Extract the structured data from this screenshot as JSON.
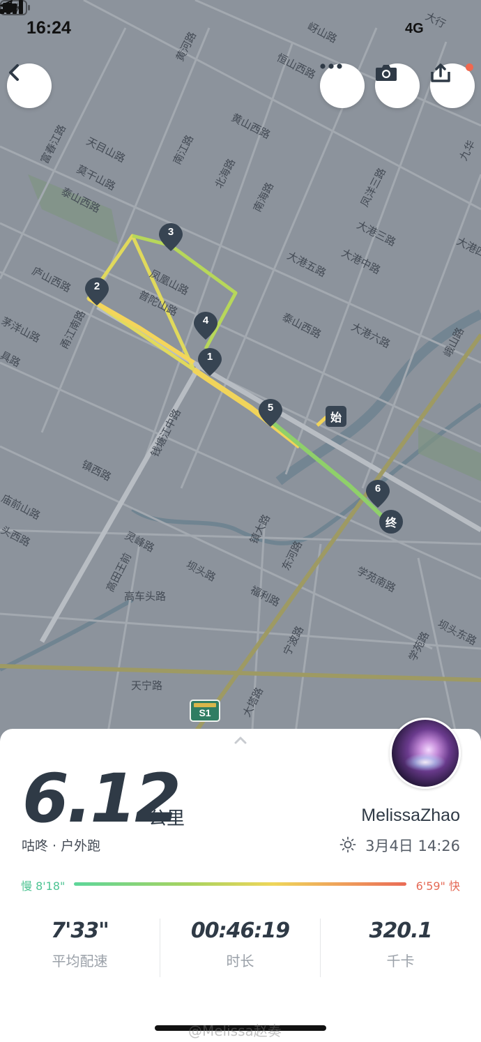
{
  "status_bar": {
    "time": "16:24",
    "network": "4G"
  },
  "map": {
    "roads": [
      "岈山路",
      "恒山西路",
      "大行",
      "黄河路",
      "黄山西路",
      "九华",
      "富春江路",
      "天目山路",
      "南江路",
      "莫干山路",
      "北海路",
      "南海路",
      "凤洋三路",
      "泰山西路",
      "大港三路",
      "大港四",
      "大港中路",
      "大港五路",
      "庐山西路",
      "凤凰山路",
      "普陀山路",
      "泰山西路",
      "大港六路",
      "峨山路",
      "茅洋山路",
      "甬江南路",
      "具路",
      "钱塘江中路",
      "镇西路",
      "庙前山路",
      "头西路",
      "灵峰路",
      "镇大路",
      "东河路",
      "学苑南路",
      "高田王前",
      "坝头路",
      "高车头路",
      "福利路",
      "坝头东路",
      "学苑路",
      "宁波路",
      "天宁路",
      "大塔路"
    ],
    "waypoints": [
      "1",
      "2",
      "3",
      "4",
      "5",
      "6"
    ],
    "start_label": "始",
    "end_label": "终",
    "highway_shield": "S1"
  },
  "buttons": {
    "back": "chevron-left-icon",
    "more": "more-dots-icon",
    "camera": "camera-icon",
    "share": "share-icon"
  },
  "summary": {
    "distance": "6.12",
    "unit": "公里",
    "activity": "咕咚 · 户外跑",
    "username": "MelissaZhao",
    "date": "3月4日 14:26",
    "slow_label": "慢 8'18\"",
    "fast_label": "6'59\" 快"
  },
  "stats": [
    {
      "value": "7'33\"",
      "label": "平均配速"
    },
    {
      "value": "00:46:19",
      "label": "时长"
    },
    {
      "value": "320.1",
      "label": "千卡"
    }
  ],
  "watermark": "@Melissa赵奏",
  "colors": {
    "map_bg": "#8c939c",
    "route_green": "#8fd06a",
    "route_yellow": "#f0d556",
    "pin": "#374452"
  }
}
